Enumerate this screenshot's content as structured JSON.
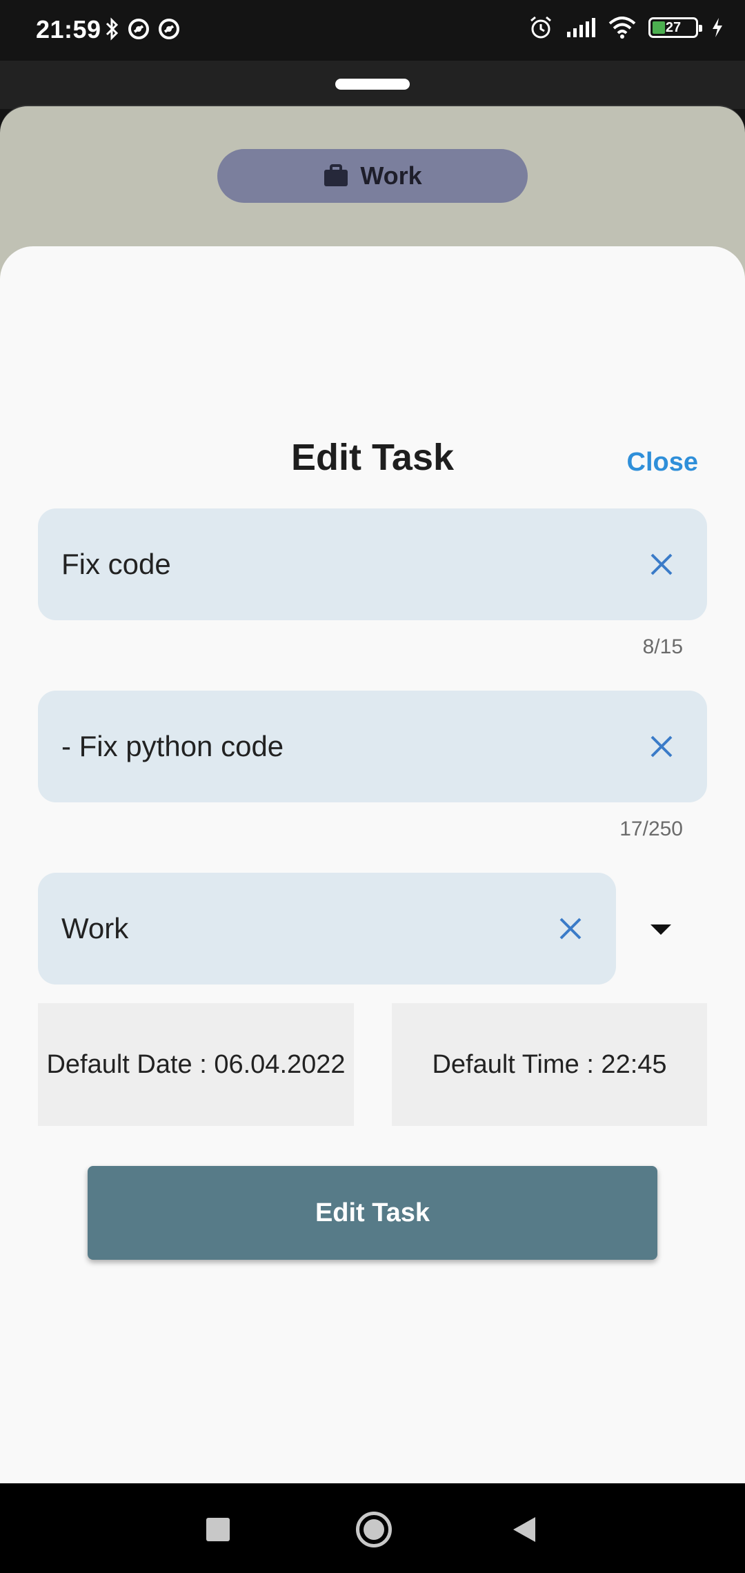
{
  "status_bar": {
    "time": "21:59",
    "battery": "27",
    "left_icons": [
      "bluetooth-icon",
      "vpn-icon",
      "vpn-icon"
    ],
    "right_icons": [
      "alarm-icon",
      "signal-icon",
      "wifi-icon",
      "battery-icon",
      "charging-icon"
    ]
  },
  "background": {
    "chip_label": "Work",
    "chip_icon": "briefcase-icon"
  },
  "sheet": {
    "title": "Edit Task",
    "close_label": "Close",
    "title_field": {
      "value": "Fix code",
      "counter": "8/15"
    },
    "description_field": {
      "value": "- Fix python code",
      "counter": "17/250"
    },
    "category_field": {
      "value": "Work"
    },
    "date_label": "Default Date : 06.04.2022",
    "time_label": "Default Time : 22:45",
    "submit_label": "Edit Task"
  },
  "colors": {
    "field_bg": "#dfe9f0",
    "accent_blue": "#2f8fd9",
    "button_bg": "#577b88",
    "chip_bg": "#7b7f9d"
  }
}
